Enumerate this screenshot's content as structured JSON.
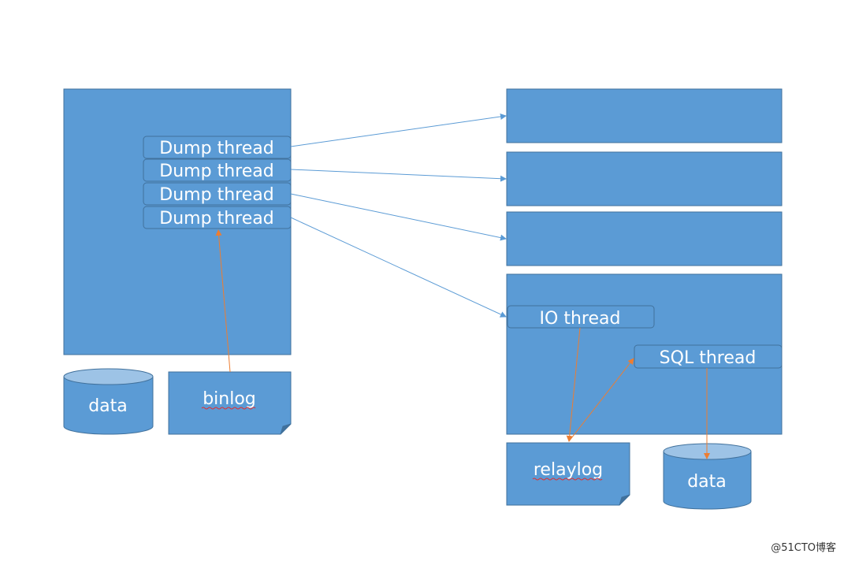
{
  "colors": {
    "box": "#5b9bd5",
    "border": "#41719c",
    "arrow_blue": "#5b9bd5",
    "arrow_orange": "#ed7d31"
  },
  "master": {
    "dump_threads": [
      "Dump thread",
      "Dump thread",
      "Dump thread",
      "Dump thread"
    ],
    "data_label": "data",
    "binlog_label": "binlog"
  },
  "slave": {
    "io_thread": "IO thread",
    "sql_thread": "SQL thread",
    "relaylog_label": "relaylog",
    "data_label": "data"
  },
  "watermark": "@51CTO博客"
}
